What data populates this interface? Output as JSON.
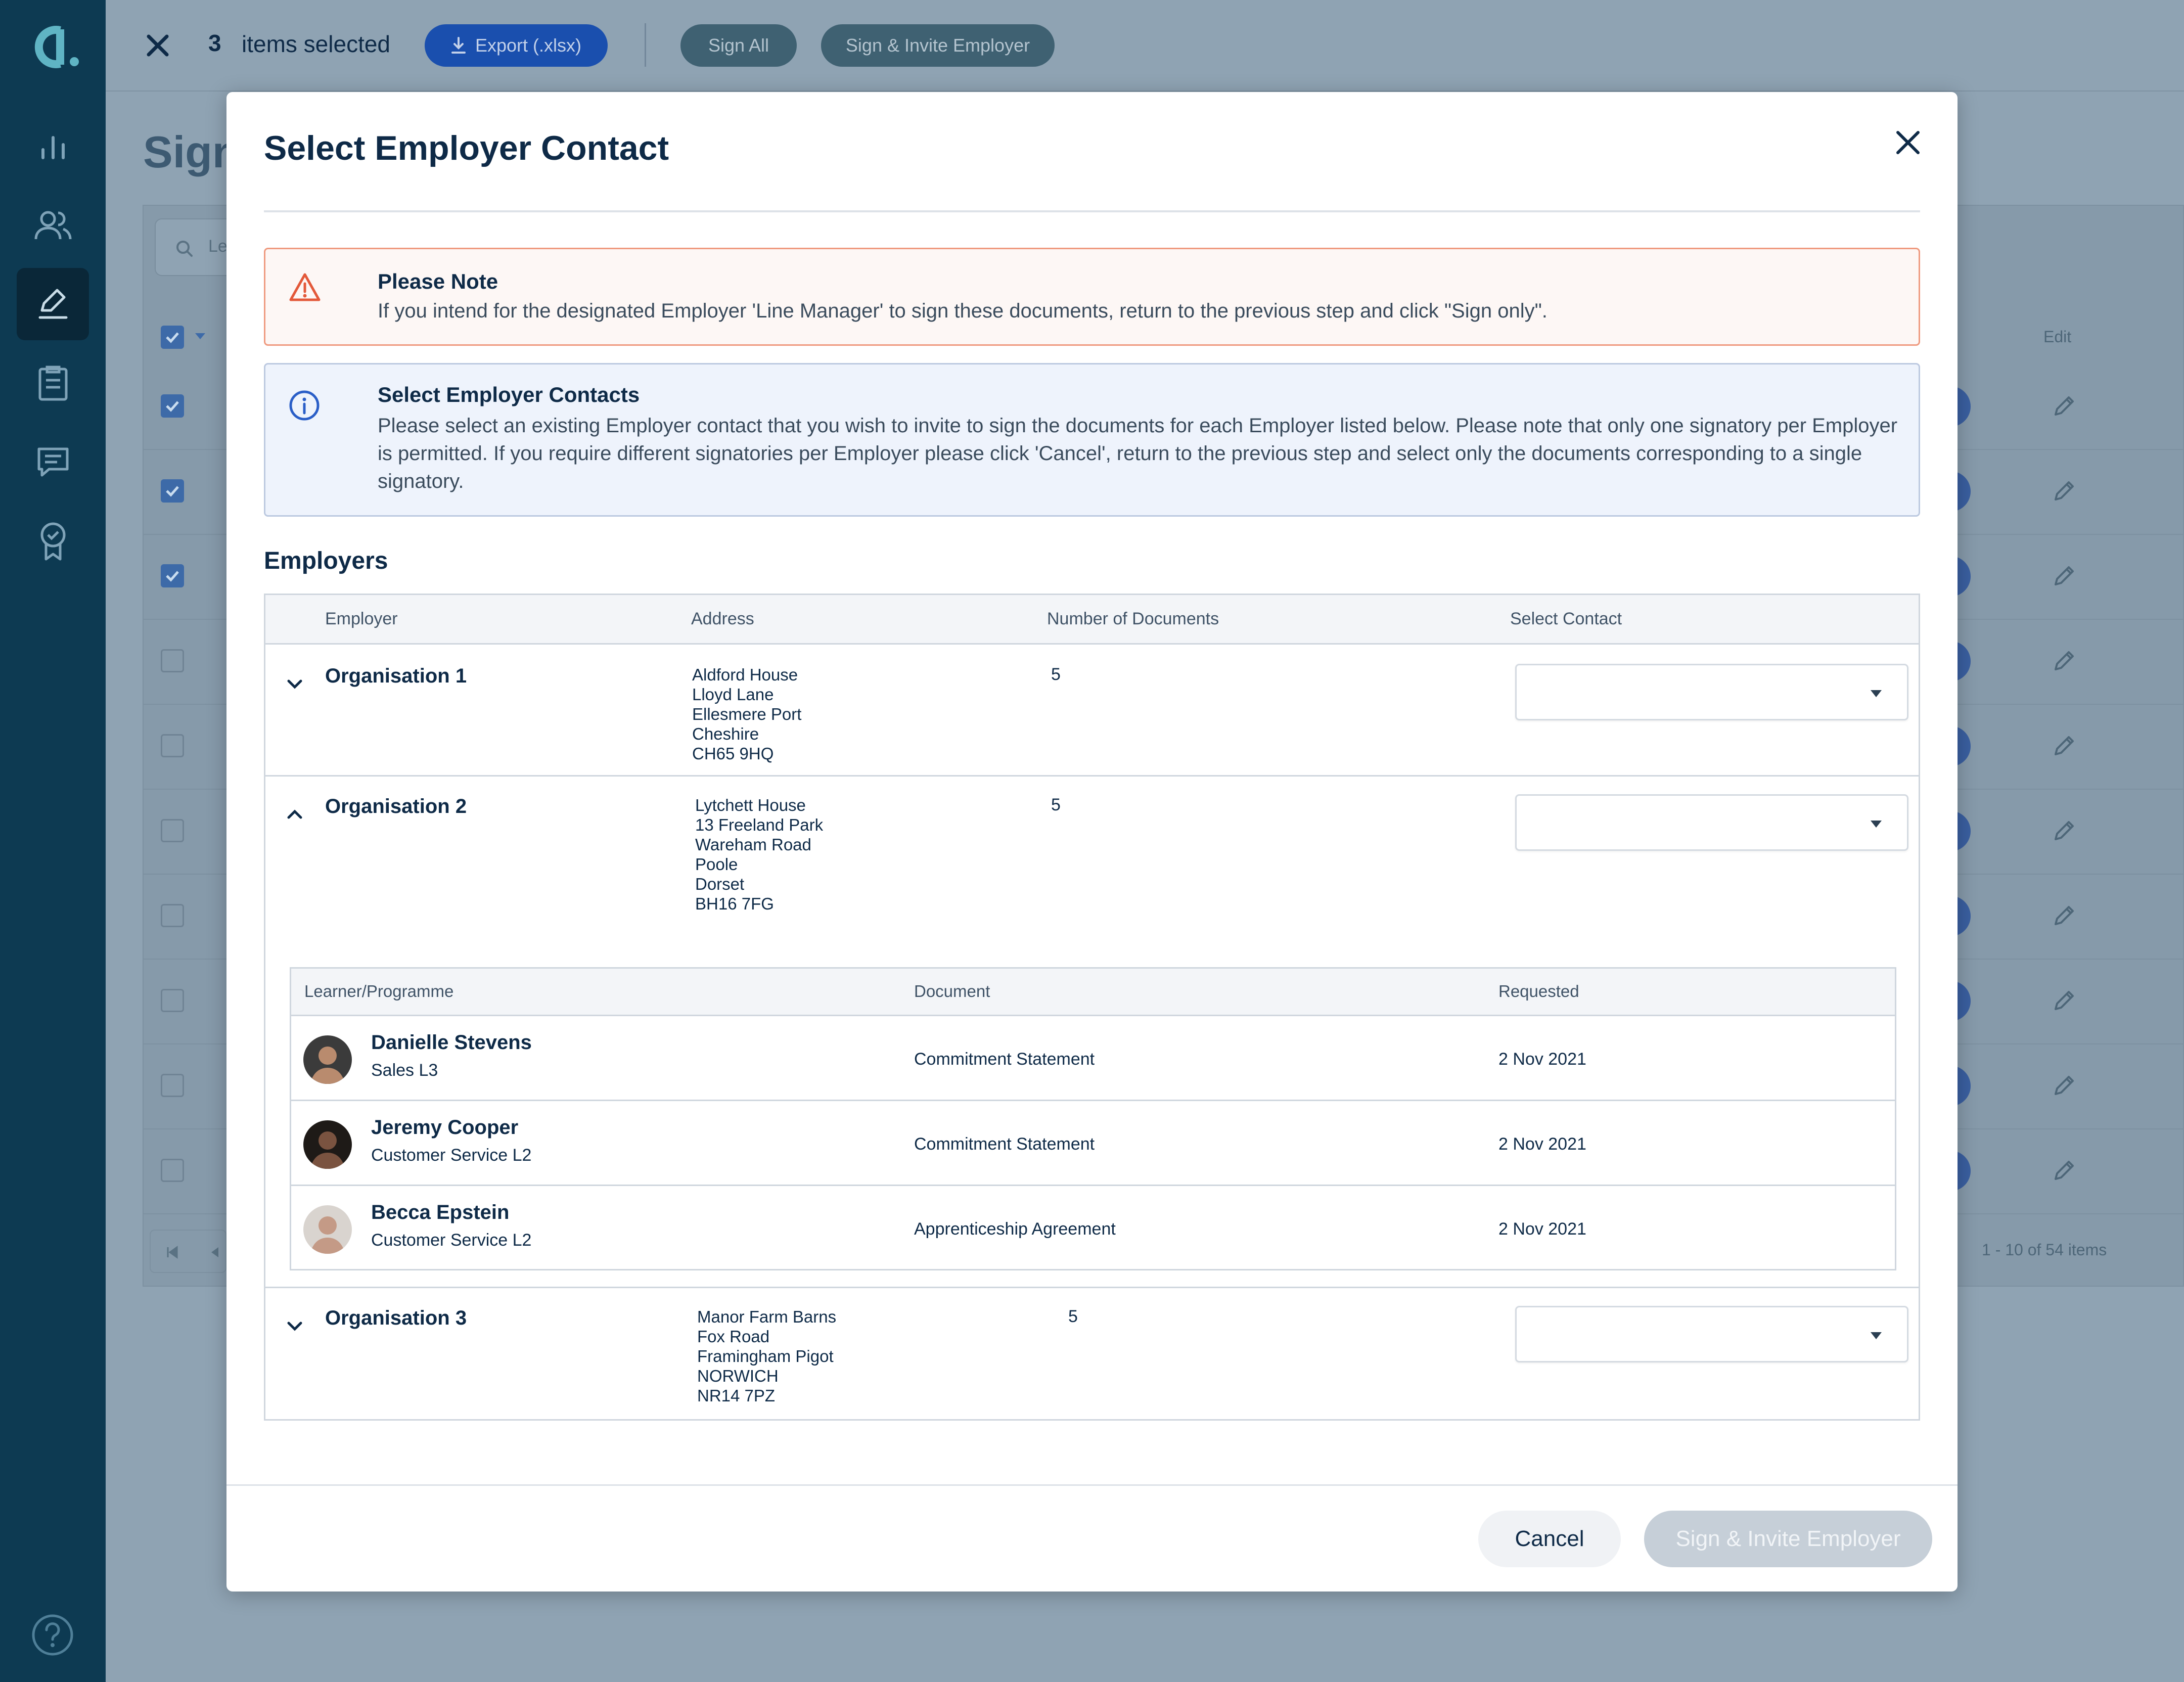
{
  "toolbar": {
    "selected_count": "3",
    "selected_label": "items selected",
    "export_label": "Export (.xlsx)",
    "sign_all_label": "Sign All",
    "sign_invite_label": "Sign & Invite Employer"
  },
  "background": {
    "page_title": "Sign",
    "search_placeholder": "Le",
    "edit_header": "Edit",
    "pagination": "1 - 10 of 54 items",
    "rows_checked": [
      true,
      true,
      true,
      false,
      false,
      false,
      false,
      false,
      false,
      false
    ]
  },
  "modal": {
    "title": "Select Employer Contact",
    "note": {
      "title": "Please Note",
      "text": "If you intend for the designated Employer 'Line Manager' to sign these documents, return to the previous step and click \"Sign only\"."
    },
    "info": {
      "title": "Select Employer Contacts",
      "text": "Please select an existing Employer contact that you wish to invite to sign the documents for each Employer listed below. Please note that only one signatory per Employer is permitted. If you require different signatories per Employer please click 'Cancel', return to the previous step and select only the documents corresponding to a single signatory."
    },
    "section_title": "Employers",
    "columns": {
      "employer": "Employer",
      "address": "Address",
      "num_docs": "Number of Documents",
      "select_contact": "Select Contact"
    },
    "employers": [
      {
        "name": "Organisation 1",
        "expanded": false,
        "address": [
          "Aldford House",
          "Lloyd Lane",
          "Ellesmere Port",
          "Cheshire",
          "CH65 9HQ"
        ],
        "documents": "5"
      },
      {
        "name": "Organisation 2",
        "expanded": true,
        "address": [
          "Lytchett House",
          "13 Freeland Park",
          "Wareham Road",
          "Poole",
          "Dorset",
          "BH16 7FG"
        ],
        "documents": "5"
      },
      {
        "name": "Organisation 3",
        "expanded": false,
        "address": [
          "Manor Farm Barns",
          "Fox Road",
          "Framingham Pigot",
          "NORWICH",
          "NR14 7PZ"
        ],
        "documents": "5"
      }
    ],
    "sub_columns": {
      "learner": "Learner/Programme",
      "document": "Document",
      "requested": "Requested"
    },
    "learners": [
      {
        "name": "Danielle Stevens",
        "programme": "Sales L3",
        "document": "Commitment Statement",
        "requested": "2 Nov 2021"
      },
      {
        "name": "Jeremy Cooper",
        "programme": "Customer Service L2",
        "document": "Commitment Statement",
        "requested": "2 Nov 2021"
      },
      {
        "name": "Becca Epstein",
        "programme": "Customer Service L2",
        "document": "Apprenticeship Agreement",
        "requested": "2 Nov 2021"
      }
    ],
    "cancel_label": "Cancel",
    "submit_label": "Sign & Invite Employer"
  },
  "colors": {
    "brand_dark": "#0d3a52",
    "text_dark": "#0e2a47",
    "warning_border": "#ef9a7f",
    "info_border": "#bcc9e0",
    "disabled_button": "#c6cfd8"
  }
}
